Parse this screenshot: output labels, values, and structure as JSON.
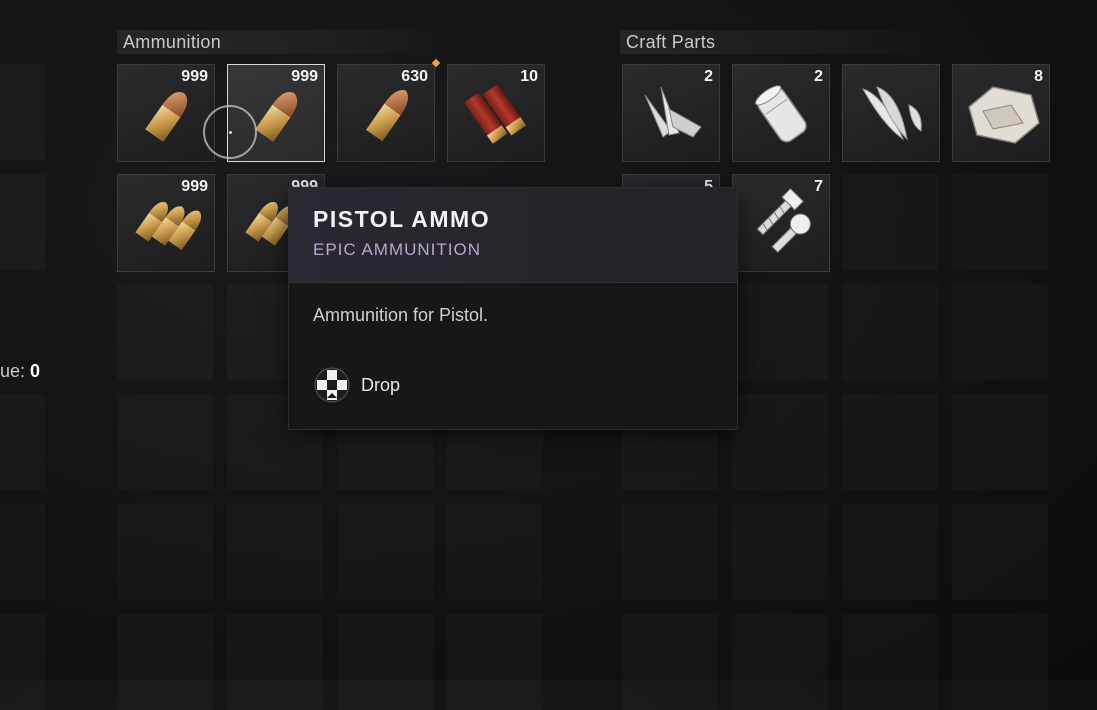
{
  "sections": {
    "ammunition": {
      "title": "Ammunition"
    },
    "craft_parts": {
      "title": "Craft Parts"
    }
  },
  "ammo_slots": [
    {
      "count": "999",
      "icon": "pistol-bullet-icon"
    },
    {
      "count": "999",
      "icon": "pistol-bullet-icon",
      "selected": true
    },
    {
      "count": "630",
      "icon": "rifle-bullet-icon",
      "new": true
    },
    {
      "count": "10",
      "icon": "shotgun-shell-icon"
    },
    {
      "count": "999",
      "icon": "bullet-stack-icon"
    },
    {
      "count": "999",
      "icon": "bullet-stack-icon"
    }
  ],
  "craft_slots": [
    {
      "count": "2",
      "icon": "blades-icon"
    },
    {
      "count": "2",
      "icon": "canister-icon"
    },
    {
      "count": "",
      "icon": "feathers-icon"
    },
    {
      "count": "8",
      "icon": "cloth-icon"
    },
    {
      "count": "5",
      "icon": "craft-part-icon"
    },
    {
      "count": "7",
      "icon": "screws-icon"
    }
  ],
  "left_panel": {
    "value_label": "ue:",
    "value": "0"
  },
  "tooltip": {
    "name": "PISTOL AMMO",
    "rarity": "EPIC AMMUNITION",
    "description": "Ammunition for Pistol.",
    "action_label": "Drop",
    "action_icon": "dpad-button-icon"
  },
  "colors": {
    "rarity_epic": "#b6a8cf",
    "new_indicator": "#f0a23c",
    "selected_border": "#d7d7d9"
  }
}
